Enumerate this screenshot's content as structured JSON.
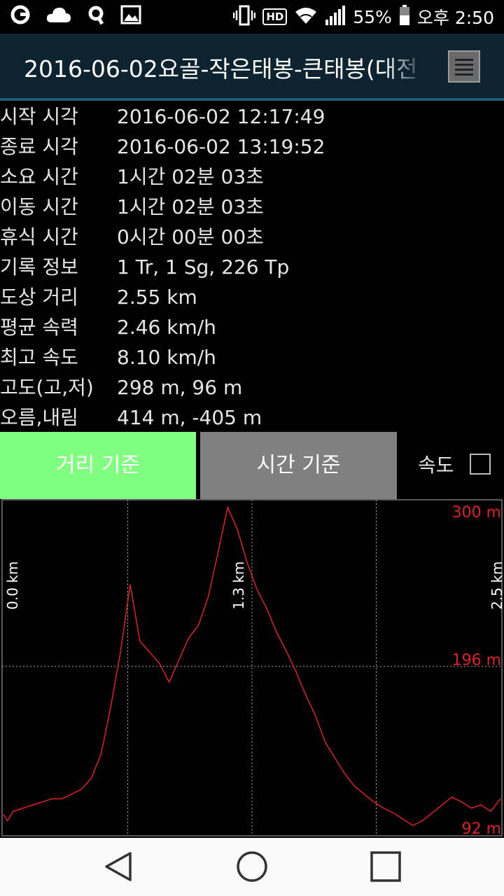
{
  "status_bar": {
    "battery_percent": "55%",
    "time": "오후 2:50",
    "hd_label": "HD"
  },
  "header": {
    "title": "2016-06-02요골-작은태봉-큰태봉(대전"
  },
  "info": [
    {
      "label": "시작 시각",
      "value": "2016-06-02 12:17:49"
    },
    {
      "label": "종료 시각",
      "value": "2016-06-02 13:19:52"
    },
    {
      "label": "소요 시간",
      "value": "1시간 02분 03초"
    },
    {
      "label": "이동 시간",
      "value": "1시간 02분 03초"
    },
    {
      "label": "휴식 시간",
      "value": "0시간 00분 00초"
    },
    {
      "label": "기록 정보",
      "value": "1 Tr, 1 Sg, 226 Tp"
    },
    {
      "label": "도상 거리",
      "value": "2.55 km"
    },
    {
      "label": "평균 속력",
      "value": "2.46 km/h"
    },
    {
      "label": "최고 속도",
      "value": "8.10 km/h"
    },
    {
      "label": "고도(고,저)",
      "value": "298 m, 96 m"
    },
    {
      "label": "오름,내림",
      "value": "414 m, -405 m"
    }
  ],
  "controls": {
    "distance_button": "거리 기준",
    "time_button": "시간 기준",
    "speed_label": "속도",
    "speed_checked": false
  },
  "chart_data": {
    "type": "line",
    "x_tick_labels": [
      "0.0 km",
      "1.3 km",
      "2.5 km"
    ],
    "x_ticks": [
      0,
      1.275,
      2.55
    ],
    "y_tick_labels": [
      "300 m",
      "196 m",
      "92 m"
    ],
    "xlim": [
      0,
      2.55
    ],
    "ylim": [
      92,
      300
    ],
    "grid": true,
    "line_color": "#e02020",
    "x": [
      0,
      0.02,
      0.05,
      0.1,
      0.15,
      0.2,
      0.25,
      0.3,
      0.35,
      0.4,
      0.45,
      0.5,
      0.55,
      0.6,
      0.65,
      0.7,
      0.75,
      0.8,
      0.85,
      0.9,
      0.95,
      1.0,
      1.05,
      1.1,
      1.15,
      1.2,
      1.25,
      1.3,
      1.35,
      1.4,
      1.45,
      1.5,
      1.55,
      1.6,
      1.65,
      1.7,
      1.75,
      1.8,
      1.85,
      1.9,
      1.95,
      2.0,
      2.05,
      2.1,
      2.15,
      2.2,
      2.25,
      2.3,
      2.35,
      2.4,
      2.45,
      2.5,
      2.55
    ],
    "y": [
      102,
      98,
      104,
      106,
      108,
      110,
      112,
      112,
      115,
      118,
      125,
      140,
      170,
      205,
      248,
      212,
      205,
      198,
      186,
      200,
      214,
      222,
      240,
      268,
      297,
      283,
      262,
      245,
      233,
      218,
      206,
      193,
      178,
      165,
      148,
      138,
      128,
      120,
      115,
      110,
      106,
      103,
      99,
      95,
      98,
      103,
      108,
      113,
      110,
      106,
      108,
      104,
      112
    ]
  }
}
